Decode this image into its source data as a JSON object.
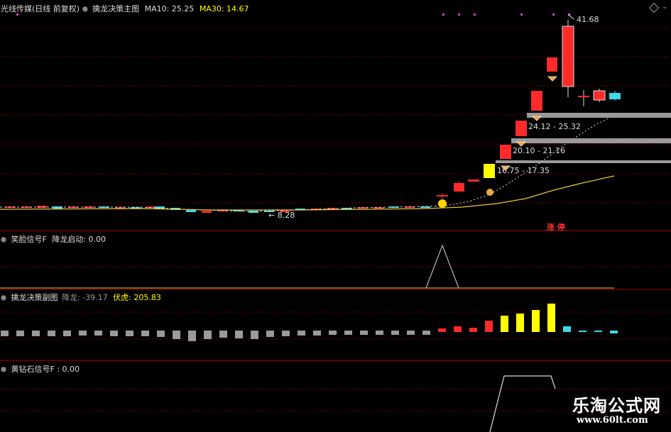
{
  "main_header": {
    "stock": "光线传媒(日线 前复权)",
    "indicator": "擒龙决策主图",
    "ma10": "MA10: 25.25",
    "ma30": "MA30: 14.67"
  },
  "sub1_header": {
    "name": "笑脸信号F",
    "value": "降龙启动: 0.00"
  },
  "sub2_header": {
    "name": "擒龙决策副图",
    "v1": "降龙: -39.17",
    "v2": "伏虎: 205.83"
  },
  "sub3_header": {
    "name": "黄钻石信号F",
    "value": ": 0.00"
  },
  "annotations": {
    "high": "41.68",
    "low": "8.28",
    "range_1": "24.12 - 25.32",
    "range_2": "20.10 - 21.16",
    "range_3": "16.75 - 17.35",
    "zhangting": "涨 停"
  },
  "watermark": {
    "name": "乐淘公式网",
    "url": "www.60lt.com"
  },
  "colors": {
    "up": "#ff2a2a",
    "down": "#3fd8e8",
    "yellow": "#ffff00",
    "gold": "#e8c840",
    "grid": "#8b0000",
    "gray": "#9a9a9a"
  },
  "chart_data": [
    {
      "type": "candlestick",
      "title": "擒龙决策主图",
      "annotations": [
        "41.68",
        "8.28",
        "24.12 - 25.32",
        "20.10 - 21.16",
        "16.75 - 17.35"
      ],
      "series": [
        {
          "name": "MA10",
          "values_last": 25.25
        },
        {
          "name": "MA30",
          "values_last": 14.67
        }
      ],
      "high": 41.68,
      "low": 8.28
    },
    {
      "type": "line",
      "title": "笑脸信号F",
      "series": [
        {
          "name": "降龙启动",
          "values_last": 0.0
        }
      ]
    },
    {
      "type": "bar",
      "title": "擒龙决策副图",
      "series": [
        {
          "name": "降龙",
          "values_last": -39.17
        },
        {
          "name": "伏虎",
          "values_last": 205.83
        }
      ]
    },
    {
      "type": "line",
      "title": "黄钻石信号F",
      "series": [
        {
          "name": "",
          "values_last": 0.0
        }
      ]
    }
  ]
}
